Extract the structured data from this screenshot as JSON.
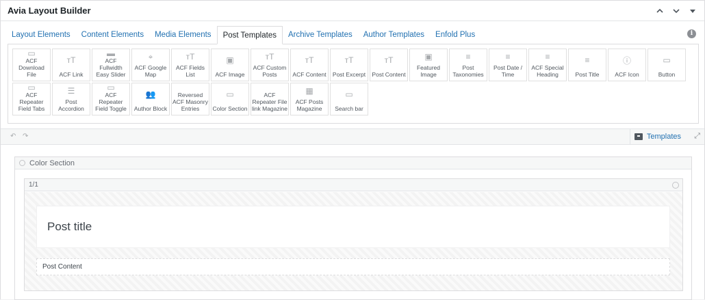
{
  "header": {
    "title": "Avia Layout Builder",
    "collapse_icon": "chevron-up-icon",
    "expand_icon": "chevron-down-icon",
    "toggle_icon": "triangle-down-icon"
  },
  "tabs": [
    {
      "label": "Layout Elements",
      "active": false
    },
    {
      "label": "Content Elements",
      "active": false
    },
    {
      "label": "Media Elements",
      "active": false
    },
    {
      "label": "Post Templates",
      "active": true
    },
    {
      "label": "Archive Templates",
      "active": false
    },
    {
      "label": "Author Templates",
      "active": false
    },
    {
      "label": "Enfold Plus",
      "active": false
    }
  ],
  "elements": [
    {
      "label": "ACF Download File",
      "icon": "file-icon",
      "glyph": "▭"
    },
    {
      "label": "ACF Link",
      "icon": "text-icon",
      "glyph": "тT"
    },
    {
      "label": "ACF Fullwidth Easy Slider",
      "icon": "slider-icon",
      "glyph": "▬"
    },
    {
      "label": "ACF Google Map",
      "icon": "map-pin-icon",
      "glyph": "⌖"
    },
    {
      "label": "ACF Fields List",
      "icon": "text-icon",
      "glyph": "тT"
    },
    {
      "label": "ACF Image",
      "icon": "image-icon",
      "glyph": "▣"
    },
    {
      "label": "ACF Custom Posts",
      "icon": "text-icon",
      "glyph": "тT"
    },
    {
      "label": "ACF Content",
      "icon": "text-icon",
      "glyph": "тT"
    },
    {
      "label": "Post Excerpt",
      "icon": "text-icon",
      "glyph": "тT"
    },
    {
      "label": "Post Content",
      "icon": "text-icon",
      "glyph": "тT"
    },
    {
      "label": "Featured Image",
      "icon": "image-icon",
      "glyph": "▣"
    },
    {
      "label": "Post Taxonomies",
      "icon": "lines-icon",
      "glyph": "≡"
    },
    {
      "label": "Post Date / Time",
      "icon": "lines-icon",
      "glyph": "≡"
    },
    {
      "label": "ACF Special Heading",
      "icon": "lines-icon",
      "glyph": "≡"
    },
    {
      "label": "Post Title",
      "icon": "lines-icon",
      "glyph": "≡"
    },
    {
      "label": "ACF Icon",
      "icon": "info-icon",
      "glyph": "ⓘ"
    },
    {
      "label": "Button",
      "icon": "button-icon",
      "glyph": "▭"
    },
    {
      "label": "ACF Repeater Field Tabs",
      "icon": "tabs-icon",
      "glyph": "▭"
    },
    {
      "label": "Post Accordion",
      "icon": "accordion-icon",
      "glyph": "☰"
    },
    {
      "label": "ACF Repeater Field Toggle",
      "icon": "toggle-icon",
      "glyph": "▭"
    },
    {
      "label": "Author Block",
      "icon": "users-icon",
      "glyph": "👥"
    },
    {
      "label": "Reversed ACF Masonry Entries",
      "icon": "masonry-icon",
      "glyph": ""
    },
    {
      "label": "Color Section",
      "icon": "section-icon",
      "glyph": "▭"
    },
    {
      "label": "ACF Repeater File link Magazine",
      "icon": "file-icon",
      "glyph": ""
    },
    {
      "label": "ACF Posts Magazine",
      "icon": "grid-icon",
      "glyph": "▦"
    },
    {
      "label": "Search bar",
      "icon": "search-bar-icon",
      "glyph": "▭"
    }
  ],
  "toolbar": {
    "undo_icon": "undo-icon",
    "redo_icon": "redo-icon",
    "templates_label": "Templates",
    "fullscreen_icon": "expand-icon"
  },
  "canvas": {
    "section_label": "Color Section",
    "column_label": "1/1",
    "title_text": "Post title",
    "content_text": "Post Content"
  },
  "colors": {
    "link": "#2271b1",
    "text": "#1d2327",
    "border": "#dcdcde"
  }
}
